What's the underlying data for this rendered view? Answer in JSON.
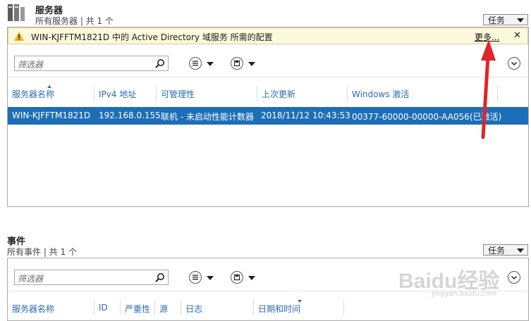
{
  "servers": {
    "title": "服务器",
    "subtitle": "所有服务器 | 共 1 个",
    "tasks_label": "任务",
    "notification": {
      "message": "WIN-KJFFTM1821D 中的 Active Directory 域服务 所需的配置",
      "more_link": "更多...",
      "close": "✕"
    },
    "filter_placeholder": "筛选器",
    "columns": [
      "服务器名称",
      "IPv4 地址",
      "可管理性",
      "上次更新",
      "Windows 激活"
    ],
    "rows": [
      [
        "WIN-KJFFTM1821D",
        "192.168.0.155",
        "联机 - 未启动性能计数器",
        "2018/11/12 10:43:53",
        "00377-60000-00000-AA056(已激活)"
      ]
    ]
  },
  "events": {
    "title": "事件",
    "subtitle": "所有事件 | 共 1 个",
    "tasks_label": "任务",
    "filter_placeholder": "筛选器",
    "columns": [
      "服务器名称",
      "ID",
      "严重性",
      "源",
      "日志",
      "日期和时间"
    ]
  },
  "watermark": {
    "text": "Baidu经验",
    "url_text": "jingyan.baidu.com"
  },
  "colors": {
    "accent": "#1d6eb8",
    "header_text": "#2b6cb0",
    "warn_bg": "#fcf8dc",
    "arrow": "#e0252b"
  }
}
